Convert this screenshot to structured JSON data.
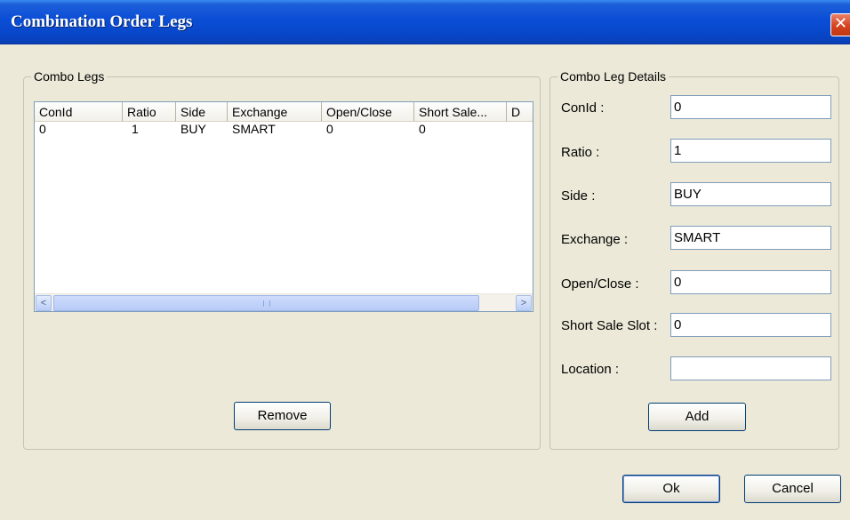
{
  "window": {
    "title": "Combination Order Legs",
    "close_glyph": "✕"
  },
  "combo_legs": {
    "legend": "Combo Legs",
    "columns": [
      "ConId",
      "Ratio",
      "Side",
      "Exchange",
      "Open/Close",
      "Short Sale...",
      "D"
    ],
    "rows": [
      [
        "0",
        "1",
        "BUY",
        "SMART",
        "0",
        "0",
        ""
      ]
    ],
    "remove_label": "Remove",
    "scroll_left_glyph": "<",
    "scroll_right_glyph": ">"
  },
  "details": {
    "legend": "Combo Leg Details",
    "fields": [
      {
        "label": "ConId :",
        "value": "0"
      },
      {
        "label": "Ratio :",
        "value": "1"
      },
      {
        "label": "Side :",
        "value": "BUY"
      },
      {
        "label": "Exchange :",
        "value": "SMART"
      },
      {
        "label": "Open/Close :",
        "value": "0"
      },
      {
        "label": "Short Sale Slot :",
        "value": "0"
      },
      {
        "label": "Location :",
        "value": ""
      }
    ],
    "add_label": "Add"
  },
  "footer": {
    "ok_label": "Ok",
    "cancel_label": "Cancel"
  }
}
